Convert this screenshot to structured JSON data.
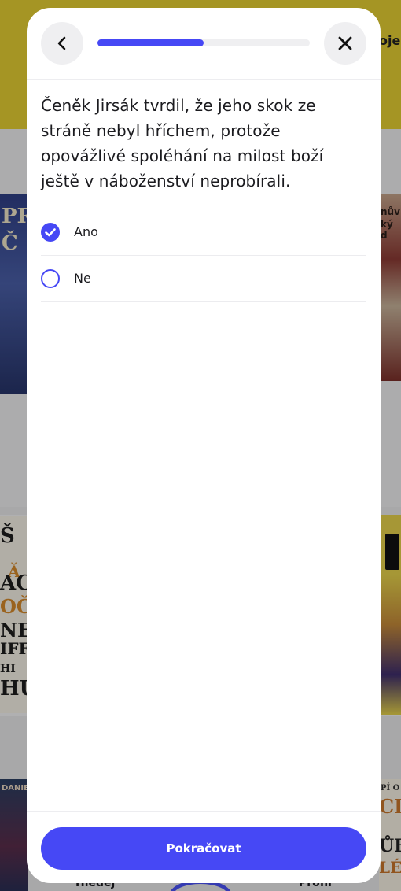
{
  "background": {
    "topbar_fragment": "oje",
    "nav_left_label": "Hledej",
    "nav_right_label": "Profil"
  },
  "modal": {
    "progress_fraction": 0.5,
    "question": "Čeněk Jirsák tvrdil, že jeho skok ze stráně nebyl hříchem, protože opovážlivé spoléhání na milost boží ještě v náboženství neprobírali.",
    "options": [
      {
        "label": "Ano",
        "selected": true
      },
      {
        "label": "Ne",
        "selected": false
      }
    ],
    "continue_label": "Pokračovat"
  },
  "colors": {
    "accent": "#4648f5",
    "topbar": "#e5cf33"
  },
  "icons": {
    "back": "chevron-left-icon",
    "close": "close-icon",
    "checked": "check-icon"
  }
}
